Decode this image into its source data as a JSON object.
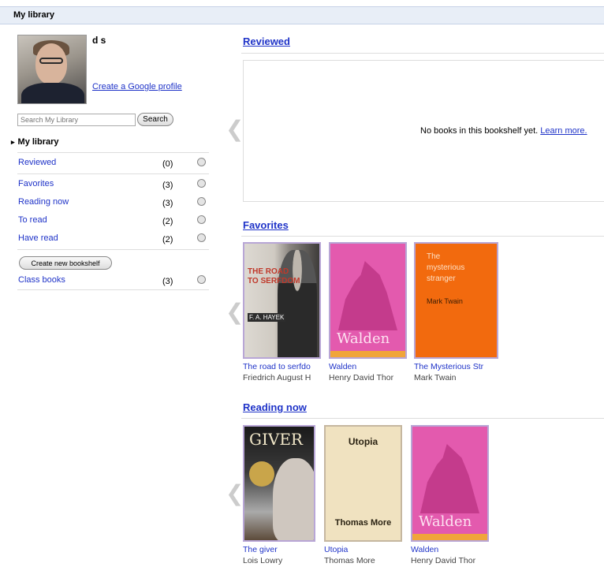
{
  "header": {
    "title": "My library"
  },
  "profile": {
    "name": "d s",
    "link": "Create a Google profile"
  },
  "search": {
    "placeholder": "Search My Library",
    "button": "Search"
  },
  "sidebar": {
    "heading": "My library",
    "shelves": [
      {
        "label": "Reviewed",
        "count": "(0)"
      },
      {
        "label": "Favorites",
        "count": "(3)"
      },
      {
        "label": "Reading now",
        "count": "(3)"
      },
      {
        "label": "To read",
        "count": "(2)"
      },
      {
        "label": "Have read",
        "count": "(2)"
      }
    ],
    "new_shelf_button": "Create new bookshelf",
    "custom_shelves": [
      {
        "label": "Class books",
        "count": "(3)"
      }
    ]
  },
  "sections": {
    "reviewed": {
      "title": "Reviewed",
      "empty_text": "No books in this bookshelf yet.",
      "learn_more": "Learn more."
    },
    "favorites": {
      "title": "Favorites",
      "books": [
        {
          "title": "The road to serfdo",
          "author": "Friedrich August H",
          "cover_title": "THE ROAD\nTO SERFDOM",
          "cover_author": "F. A. HAYEK"
        },
        {
          "title": "Walden",
          "author": "Henry David Thor",
          "cover_title": "Walden"
        },
        {
          "title": "The Mysterious Str",
          "author": "Mark Twain",
          "cover_title": "The\nmysterious\nstranger",
          "cover_author": "Mark Twain"
        }
      ]
    },
    "reading_now": {
      "title": "Reading now",
      "books": [
        {
          "title": "The giver",
          "author": "Lois Lowry",
          "cover_title": "GIVER"
        },
        {
          "title": "Utopia",
          "author": "Thomas More",
          "cover_title": "Utopia",
          "cover_author": "Thomas More"
        },
        {
          "title": "Walden",
          "author": "Henry David Thor",
          "cover_title": "Walden"
        }
      ]
    }
  },
  "colors": {
    "link": "#1f33c8",
    "header_bg": "#e8eef7",
    "walden_pink": "#e35aae",
    "twain_orange": "#f26a0e"
  },
  "icons": {
    "carousel_prev": "chevron-left-icon",
    "shelf_public": "globe-icon"
  }
}
